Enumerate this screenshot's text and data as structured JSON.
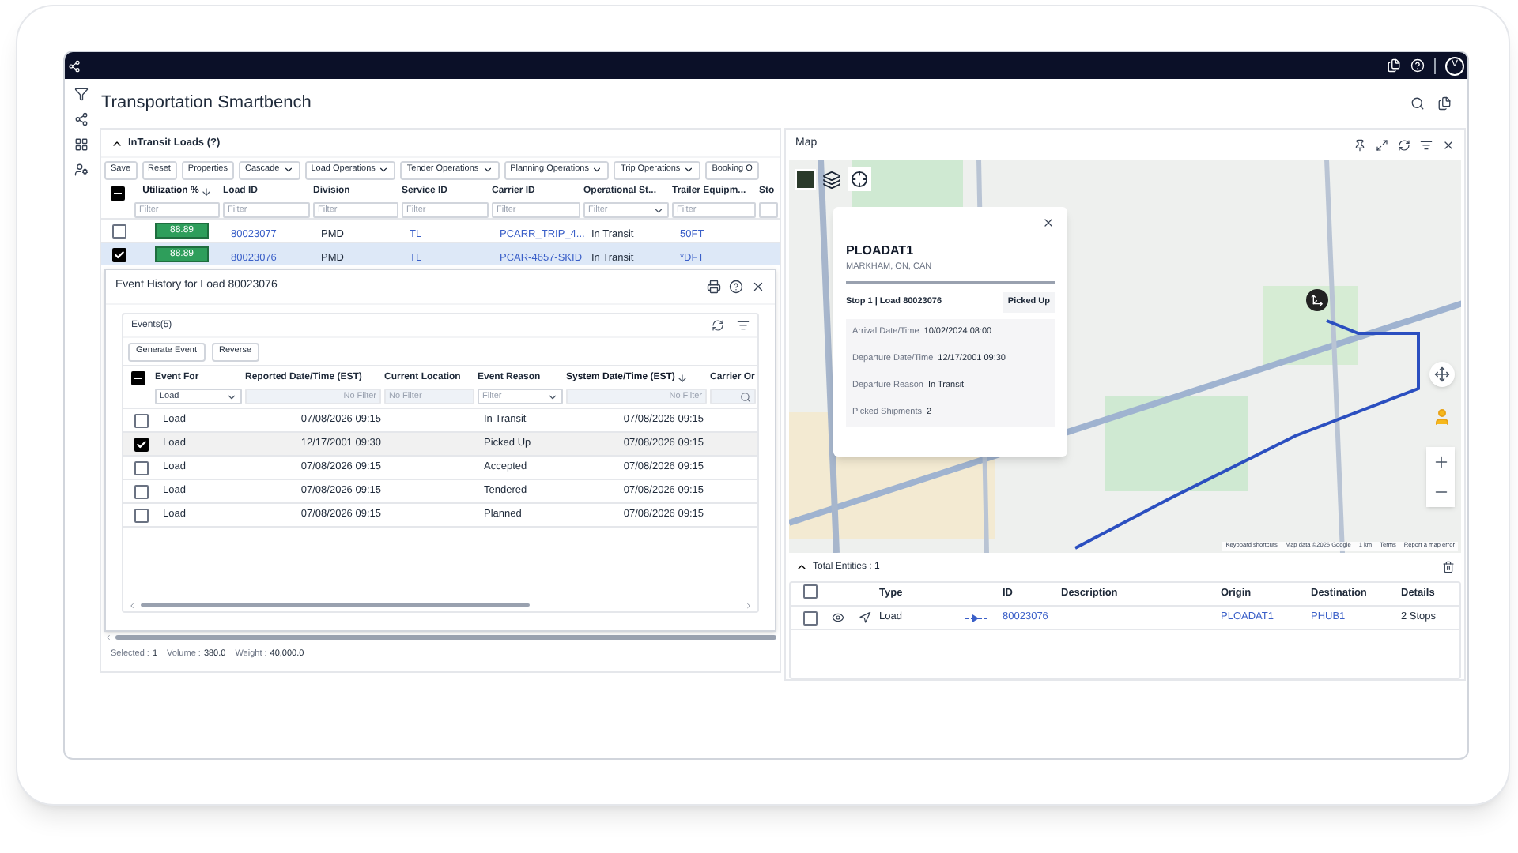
{
  "top_bar": {
    "user_initial": "V"
  },
  "page_title": "Transportation Smartbench",
  "loads_panel": {
    "title": "InTransit Loads (?)",
    "expanded": true,
    "toolbar": [
      {
        "label": "Save",
        "kind": "button"
      },
      {
        "label": "Reset",
        "kind": "button"
      },
      {
        "label": "Properties",
        "kind": "button"
      },
      {
        "label": "Cascade",
        "kind": "menu"
      },
      {
        "label": "Load Operations",
        "kind": "menu"
      },
      {
        "label": "Tender Operations",
        "kind": "menu"
      },
      {
        "label": "Planning Operations",
        "kind": "menu"
      },
      {
        "label": "Trip Operations",
        "kind": "menu"
      },
      {
        "label": "Booking O",
        "kind": "button"
      }
    ],
    "some_selected": true,
    "columns": [
      {
        "label": "Utilization %",
        "sorted": true,
        "filter": {
          "kind": "text",
          "placeholder": "Filter",
          "disabled": false
        }
      },
      {
        "label": "Load ID",
        "sorted": false,
        "filter": {
          "kind": "text",
          "placeholder": "Filter",
          "disabled": false
        }
      },
      {
        "label": "Division",
        "sorted": false,
        "filter": {
          "kind": "text",
          "placeholder": "Filter",
          "disabled": false
        }
      },
      {
        "label": "Service ID",
        "sorted": false,
        "filter": {
          "kind": "text",
          "placeholder": "Filter",
          "disabled": false
        }
      },
      {
        "label": "Carrier ID",
        "sorted": false,
        "filter": {
          "kind": "text",
          "placeholder": "Filter",
          "disabled": false
        }
      },
      {
        "label": "Operational St...",
        "sorted": false,
        "filter": {
          "kind": "select",
          "placeholder": "Filter",
          "disabled": false
        }
      },
      {
        "label": "Trailer Equipm...",
        "sorted": false,
        "filter": {
          "kind": "text",
          "placeholder": "Filter",
          "disabled": false
        }
      },
      {
        "label": "Sto",
        "sorted": false,
        "filter": {
          "kind": "text",
          "disabled": false
        }
      }
    ],
    "rows": [
      {
        "selected": false,
        "utilization": "88.89",
        "load_id": "80023077",
        "division": "PMD",
        "service_id": "TL",
        "carrier_id": "PCARR_TRIP_4...",
        "status": "In Transit",
        "trailer": "50FT"
      },
      {
        "selected": true,
        "utilization": "88.89",
        "load_id": "80023076",
        "division": "PMD",
        "service_id": "TL",
        "carrier_id": "PCAR-4657-SKID",
        "status": "In Transit",
        "trailer": "*DFT"
      }
    ],
    "footer": [
      {
        "label": "Selected :",
        "value": "1"
      },
      {
        "label": "Volume :",
        "value": "380.0"
      },
      {
        "label": "Weight :",
        "value": "40,000.0"
      }
    ]
  },
  "event_history": {
    "title": "Event History for Load 80023076",
    "events_title": "Events(5)",
    "buttons": [
      "Generate Event",
      "Reverse"
    ],
    "some_selected": true,
    "columns": [
      {
        "label": "Event For",
        "sorted": false,
        "filter": {
          "kind": "select",
          "value": "Load",
          "disabled": false
        }
      },
      {
        "label": "Reported Date/Time (EST)",
        "sorted": false,
        "filter": {
          "kind": "text",
          "placeholder": "No Filter",
          "disabled": true
        }
      },
      {
        "label": "Current Location",
        "sorted": false,
        "filter": {
          "kind": "text",
          "placeholder": "No Filter",
          "disabled": true
        }
      },
      {
        "label": "Event Reason",
        "sorted": false,
        "filter": {
          "kind": "select",
          "placeholder": "Filter",
          "disabled": false
        }
      },
      {
        "label": "System Date/Time (EST)",
        "sorted": true,
        "filter": {
          "kind": "text",
          "placeholder": "No Filter",
          "disabled": true
        }
      },
      {
        "label": "Carrier Or",
        "sorted": false,
        "filter": {
          "kind": "search",
          "disabled": true
        }
      }
    ],
    "rows": [
      {
        "selected": false,
        "event_for": "Load",
        "reported": "07/08/2026 09:15",
        "reason": "In Transit",
        "system": "07/08/2026 09:15"
      },
      {
        "selected": true,
        "event_for": "Load",
        "reported": "12/17/2001 09:30",
        "reason": "Picked Up",
        "system": "07/08/2026 09:15"
      },
      {
        "selected": false,
        "event_for": "Load",
        "reported": "07/08/2026 09:15",
        "reason": "Accepted",
        "system": "07/08/2026 09:15"
      },
      {
        "selected": false,
        "event_for": "Load",
        "reported": "07/08/2026 09:15",
        "reason": "Tendered",
        "system": "07/08/2026 09:15"
      },
      {
        "selected": false,
        "event_for": "Load",
        "reported": "07/08/2026 09:15",
        "reason": "Planned",
        "system": "07/08/2026 09:15"
      }
    ]
  },
  "map": {
    "title": "Map",
    "popup": {
      "title": "PLOADAT1",
      "subtitle": "MARKHAM, ON, CAN",
      "stop": "Stop 1 | Load 80023076",
      "status": "Picked Up",
      "fields": [
        {
          "label": "Arrival Date/Time",
          "value": "10/02/2024 08:00"
        },
        {
          "label": "Departure Date/Time",
          "value": "12/17/2001 09:30"
        },
        {
          "label": "Departure Reason",
          "value": "In Transit"
        },
        {
          "label": "Picked Shipments",
          "value": "2"
        }
      ]
    },
    "attribution": [
      "Keyboard shortcuts",
      "Map data ©2026 Google",
      "1 km",
      "Terms",
      "Report a map error"
    ]
  },
  "entities": {
    "title": "Total Entities : 1",
    "expanded": true,
    "some_selected": false,
    "columns": [
      "Type",
      "ID",
      "Description",
      "Origin",
      "Destination",
      "Details"
    ],
    "rows": [
      {
        "checked": false,
        "type": "Load",
        "id": "80023076",
        "origin": "PLOADAT1",
        "destination": "PHUB1",
        "details": "2 Stops"
      }
    ]
  }
}
